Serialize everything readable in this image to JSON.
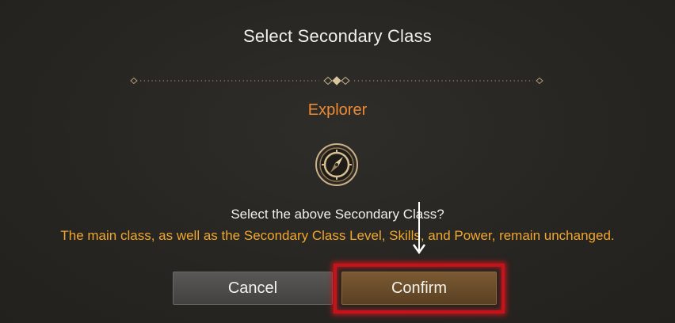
{
  "dialog": {
    "title": "Select Secondary Class",
    "class_name": "Explorer",
    "class_icon": "compass-icon",
    "question": "Select the above Secondary Class?",
    "note": "The main class, as well as the Secondary Class Level, Skills, and Power, remain unchanged."
  },
  "buttons": {
    "cancel_label": "Cancel",
    "confirm_label": "Confirm"
  },
  "colors": {
    "background": "#2a2824",
    "class_name": "#ee8a33",
    "note": "#f1a72c",
    "highlight": "#c4141b"
  }
}
